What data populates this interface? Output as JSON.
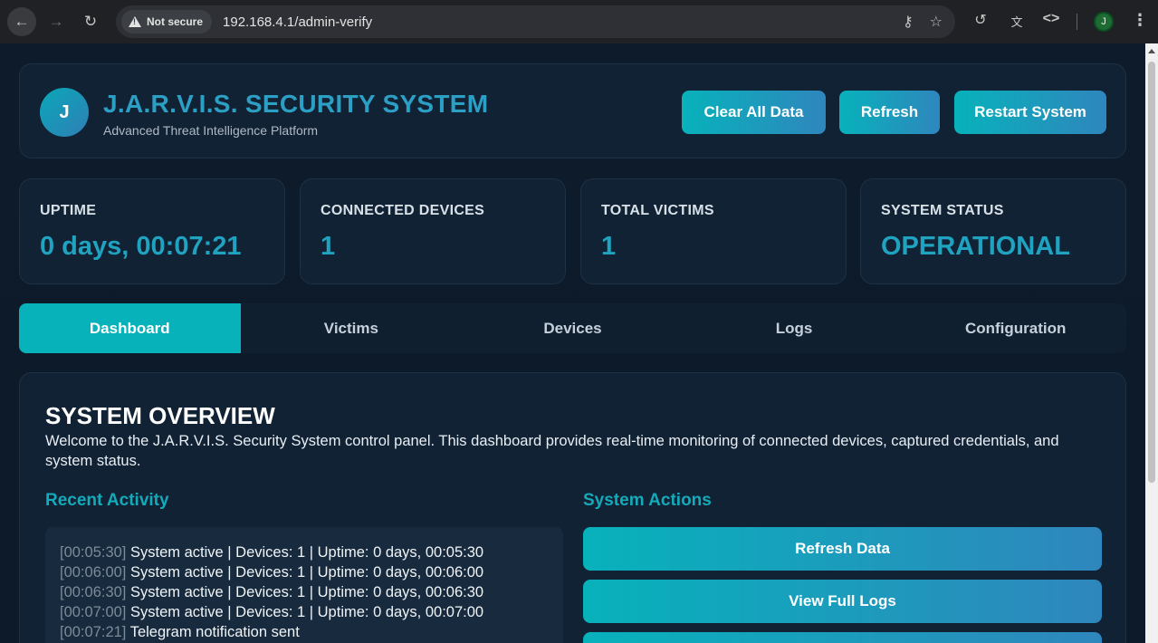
{
  "browser": {
    "security_label": "Not secure",
    "url": "192.168.4.1/admin-verify",
    "profile_initial": "J"
  },
  "header": {
    "logo_letter": "J",
    "title": "J.A.R.V.I.S. SECURITY SYSTEM",
    "subtitle": "Advanced Threat Intelligence Platform",
    "buttons": {
      "clear": "Clear All Data",
      "refresh": "Refresh",
      "restart": "Restart System"
    }
  },
  "stats": [
    {
      "label": "UPTIME",
      "value": "0 days, 00:07:21"
    },
    {
      "label": "CONNECTED DEVICES",
      "value": "1"
    },
    {
      "label": "TOTAL VICTIMS",
      "value": "1"
    },
    {
      "label": "SYSTEM STATUS",
      "value": "OPERATIONAL"
    }
  ],
  "tabs": [
    {
      "label": "Dashboard",
      "active": true
    },
    {
      "label": "Victims"
    },
    {
      "label": "Devices"
    },
    {
      "label": "Logs"
    },
    {
      "label": "Configuration"
    }
  ],
  "overview": {
    "title": "SYSTEM OVERVIEW",
    "text": "Welcome to the J.A.R.V.I.S. Security System control panel. This dashboard provides real-time monitoring of connected devices, captured credentials, and system status."
  },
  "recent_activity": {
    "heading": "Recent Activity",
    "entries": [
      {
        "time": "[00:05:30]",
        "message": "System active | Devices: 1 | Uptime: 0 days, 00:05:30"
      },
      {
        "time": "[00:06:00]",
        "message": "System active | Devices: 1 | Uptime: 0 days, 00:06:00"
      },
      {
        "time": "[00:06:30]",
        "message": "System active | Devices: 1 | Uptime: 0 days, 00:06:30"
      },
      {
        "time": "[00:07:00]",
        "message": "System active | Devices: 1 | Uptime: 0 days, 00:07:00"
      },
      {
        "time": "[00:07:21]",
        "message": "Telegram notification sent"
      }
    ]
  },
  "system_actions": {
    "heading": "System Actions",
    "buttons": [
      "Refresh Data",
      "View Full Logs"
    ]
  },
  "colors": {
    "accent": "#07b2bb",
    "accent_end": "#2f86bd",
    "background": "#0d1b2a",
    "card": "#112234"
  }
}
